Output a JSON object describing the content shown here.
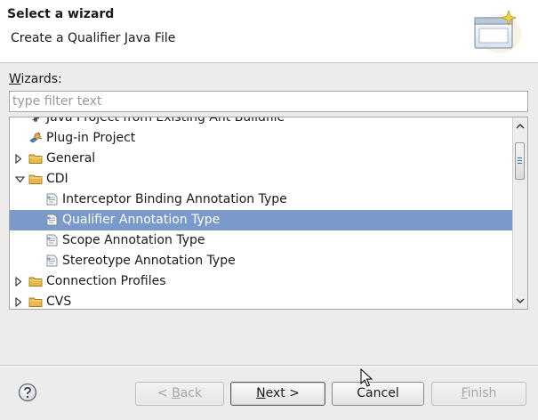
{
  "header": {
    "title": "Select a wizard",
    "description": "Create a Qualifier Java File",
    "graphic_icon": "wizard-window-sparkle-icon"
  },
  "wizards": {
    "label_mnemonic": "W",
    "label_rest": "izards:",
    "filter_placeholder": "type filter text",
    "filter_value": ""
  },
  "tree": {
    "items": [
      {
        "label": "Java Project from Existing Ant Buildfile",
        "icon": "ant-icon",
        "level": 1,
        "expander": "none",
        "selected": false
      },
      {
        "label": "Plug-in Project",
        "icon": "plugin-project-icon",
        "level": 1,
        "expander": "none",
        "selected": false
      },
      {
        "label": "General",
        "icon": "folder-icon",
        "level": 0,
        "expander": "collapsed",
        "selected": false
      },
      {
        "label": "CDI",
        "icon": "folder-icon",
        "level": 0,
        "expander": "expanded",
        "selected": false
      },
      {
        "label": "Interceptor Binding Annotation Type",
        "icon": "annotation-file-icon",
        "level": 2,
        "expander": "none",
        "selected": false
      },
      {
        "label": "Qualifier Annotation Type",
        "icon": "annotation-file-icon",
        "level": 2,
        "expander": "none",
        "selected": true
      },
      {
        "label": "Scope Annotation Type",
        "icon": "annotation-file-icon",
        "level": 2,
        "expander": "none",
        "selected": false
      },
      {
        "label": "Stereotype Annotation Type",
        "icon": "annotation-file-icon",
        "level": 2,
        "expander": "none",
        "selected": false
      },
      {
        "label": "Connection Profiles",
        "icon": "folder-icon",
        "level": 0,
        "expander": "collapsed",
        "selected": false
      },
      {
        "label": "CVS",
        "icon": "folder-icon",
        "level": 0,
        "expander": "collapsed",
        "selected": false
      }
    ]
  },
  "buttons": {
    "help_icon": "help-icon",
    "back": {
      "pre": "< ",
      "mnemonic": "B",
      "post": "ack",
      "enabled": false
    },
    "next": {
      "pre": "",
      "mnemonic": "N",
      "post": "ext >",
      "enabled": true
    },
    "cancel": {
      "label": "Cancel",
      "enabled": true
    },
    "finish": {
      "pre": "",
      "mnemonic": "F",
      "post": "inish",
      "enabled": false
    }
  },
  "colors": {
    "selection": "#7a9acb",
    "folder": "#e8b84a"
  }
}
